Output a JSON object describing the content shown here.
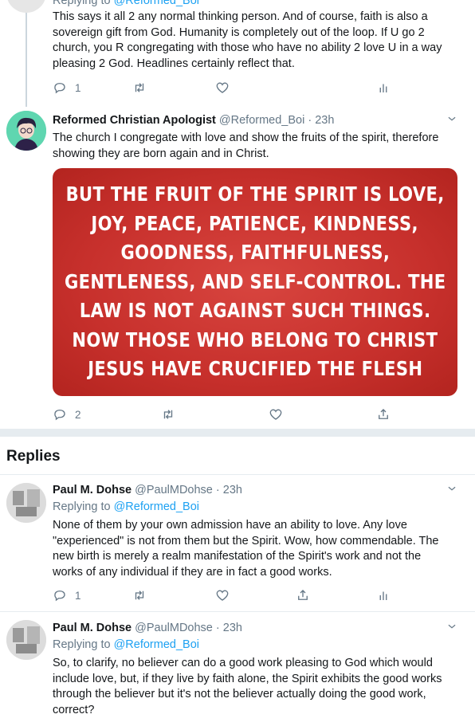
{
  "colors": {
    "link": "#1da1f2",
    "muted": "#657786",
    "text": "#14171a",
    "divider": "#e6ecf0",
    "quote_bg": "#c7302c"
  },
  "top_tweet": {
    "replying_prefix": "Replying to",
    "replying_handle": "@Reformed_Boi",
    "lines": [
      "This says it all 2 any normal thinking person. And of course, faith is also a",
      "sovereign gift from God. Humanity is completely out of the loop. If U go 2",
      "church, you R congregating with those who have no ability 2 love U in a way",
      "pleasing 2 God. Headlines certainly reflect that."
    ],
    "reply_count": "1"
  },
  "main_tweet": {
    "name": "Reformed Christian Apologist",
    "handle_time": "@Reformed_Boi · 23h",
    "lines": [
      "The church I congregate with love and show the fruits of the spirit, therefore",
      "showing they are born again and in Christ."
    ],
    "image_text": [
      "BUT THE FRUIT OF THE SPIRIT IS LOVE,",
      "JOY, PEACE, PATIENCE, KINDNESS,",
      "GOODNESS, FAITHFULNESS,",
      "GENTLENESS, AND SELF-CONTROL. THE",
      "LAW IS NOT AGAINST SUCH THINGS.",
      "NOW THOSE WHO BELONG TO CHRIST",
      "JESUS HAVE CRUCIFIED THE FLESH"
    ],
    "reply_count": "2"
  },
  "replies_header": "Replies",
  "reply1": {
    "name": "Paul M. Dohse",
    "handle_time": "@PaulMDohse · 23h",
    "replying_prefix": "Replying to",
    "replying_handle": "@Reformed_Boi",
    "lines": [
      "None of them by your own admission have an ability to love. Any love",
      "\"experienced\" is not from them but the Spirit. Wow, how commendable. The",
      "new birth is merely a realm manifestation of the Spirit's work and not the",
      "works of any individual if they are in fact a good works."
    ],
    "reply_count": "1"
  },
  "reply2": {
    "name": "Paul M. Dohse",
    "handle_time": "@PaulMDohse · 23h",
    "replying_prefix": "Replying to",
    "replying_handle": "@Reformed_Boi",
    "lines": [
      "So, to clarify, no believer can do a good work pleasing to God which would",
      "include love, but, if they live by faith alone, the Spirit exhibits the good works",
      "through the believer but it's not the believer actually doing the good work,",
      "correct?"
    ]
  }
}
